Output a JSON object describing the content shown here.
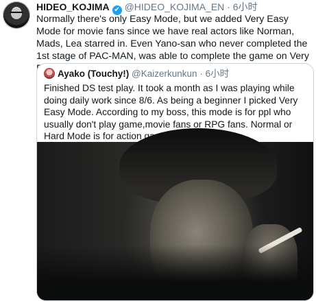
{
  "tweet": {
    "author_name": "HIDEO_KOJIMA",
    "verified_mark": "✔",
    "handle": "@HIDEO_KOJIMA_EN",
    "separator": "·",
    "time": "6小时",
    "text": "Normally there's only Easy Mode, but we added Very Easy Mode for movie fans since we have real actors like Norman, Mads, Lea starred in. Even Yano-san who never completed the 1st stage of PAC-MAN, was able to complete the game on Very Easy Mode",
    "emojis": "👍🌈🦀😅"
  },
  "quoted_tweet": {
    "author_name": "Ayako (Touchy!)",
    "handle": "@Kaizerkunkun",
    "separator": "·",
    "time": "6小时",
    "text": "Finished DS test play. It took a month as I was playing while doing daily work since 8/6. As being a beginner I picked Very Easy Mode. According to my boss, this mode is for ppl who usually don't play game,movie fans or RPG fans. Normal or Hard Mode is for action game fans."
  },
  "colors": {
    "verified": "#1da1f2",
    "secondary_text": "#657786",
    "border": "#ccd6dd"
  },
  "icons": {
    "verified": "verified-badge-icon"
  }
}
